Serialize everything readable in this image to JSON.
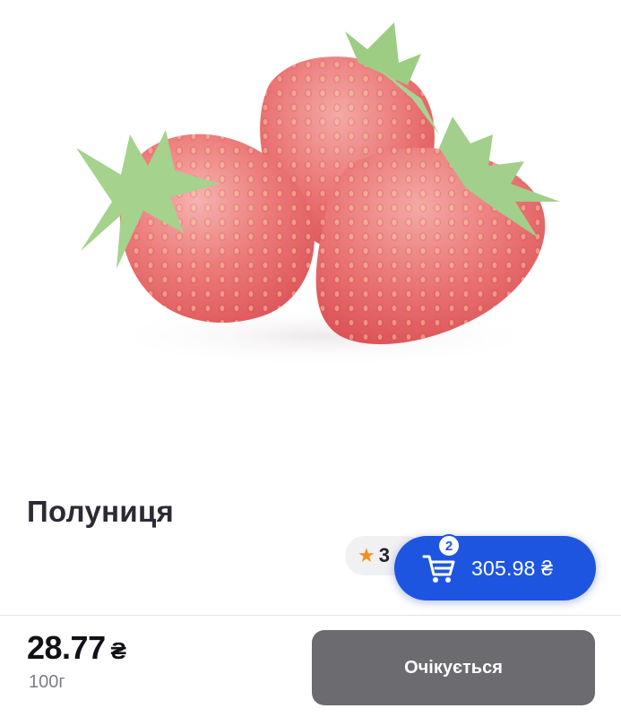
{
  "product": {
    "name": "Полуниця",
    "image_icon": "strawberries-photo",
    "rating": "3"
  },
  "cart": {
    "count": "2",
    "total": "305.98 ₴",
    "icon": "cart-icon"
  },
  "purchase": {
    "price": "28.77",
    "currency": "₴",
    "unit": "100г",
    "button_label": "Очікується"
  },
  "colors": {
    "accent": "#1e55e0",
    "rating_star": "#f5901e",
    "disabled_button": "#6b6b70"
  }
}
